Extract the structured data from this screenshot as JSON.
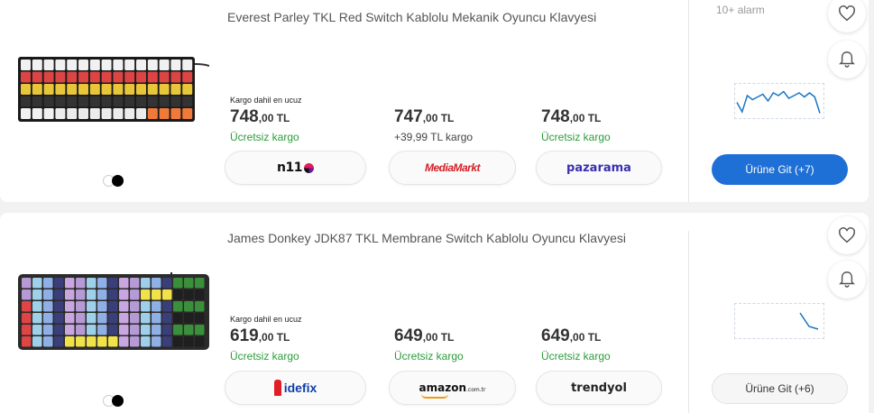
{
  "colors": {
    "accent": "#1e70d6",
    "free_shipping": "#2a9d3a",
    "chart_line": "#1c76c4"
  },
  "listings": [
    {
      "title": "Everest Parley TKL Red Switch Kablolu Mekanik Oyuncu Klavyesi",
      "alarm_text": "10+ alarm",
      "cheapest_label": "Kargo dahil en ucuz",
      "offers": [
        {
          "price_main": "748",
          "price_suffix": ",00 TL",
          "shipping": "Ücretsiz kargo",
          "store": "n11",
          "store_icon": "n11-logo"
        },
        {
          "price_main": "747",
          "price_suffix": ",00 TL",
          "shipping": "+39,99 TL kargo",
          "store": "MediaMarkt",
          "store_icon": "mediamarkt-logo"
        },
        {
          "price_main": "748",
          "price_suffix": ",00 TL",
          "shipping": "Ücretsiz kargo",
          "store": "pazarama",
          "store_icon": "pazarama-logo"
        }
      ],
      "go_button": "Ürüne Git (+7)",
      "trend": [
        0.55,
        0.9,
        0.3,
        0.45,
        0.35,
        0.25,
        0.5,
        0.2,
        0.3,
        0.15,
        0.4,
        0.3,
        0.2,
        0.35,
        0.2,
        0.35,
        0.95
      ]
    },
    {
      "title": "James Donkey JDK87 TKL Membrane Switch Kablolu Oyuncu Klavyesi",
      "alarm_text": "",
      "cheapest_label": "Kargo dahil en ucuz",
      "offers": [
        {
          "price_main": "619",
          "price_suffix": ",00 TL",
          "shipping": "Ücretsiz kargo",
          "store": "idefix",
          "store_icon": "idefix-logo"
        },
        {
          "price_main": "649",
          "price_suffix": ",00 TL",
          "shipping": "Ücretsiz kargo",
          "store": "amazon",
          "store_tld": ".com.tr",
          "store_icon": "amazon-logo"
        },
        {
          "price_main": "649",
          "price_suffix": ",00 TL",
          "shipping": "Ücretsiz kargo",
          "store": "trendyol",
          "store_icon": "trendyol-logo"
        }
      ],
      "go_button": "Ürüne Git (+6)",
      "trend": [
        0.2,
        0.7,
        0.8
      ]
    }
  ]
}
